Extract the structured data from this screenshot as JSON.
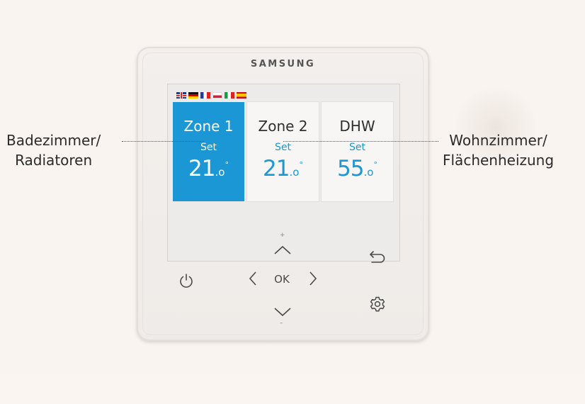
{
  "device": {
    "brand": "SAMSUNG",
    "languages": [
      "uk-flag-icon",
      "de-flag-icon",
      "fr-flag-icon",
      "pl-flag-icon",
      "it-flag-icon",
      "es-flag-icon"
    ],
    "zones": [
      {
        "title": "Zone 1",
        "set_label": "Set",
        "temp_int": "21",
        "temp_dec": ".o",
        "temp_deg": "°",
        "active": true
      },
      {
        "title": "Zone 2",
        "set_label": "Set",
        "temp_int": "21",
        "temp_dec": ".o",
        "temp_deg": "°",
        "active": false
      },
      {
        "title": "DHW",
        "set_label": "Set",
        "temp_int": "55",
        "temp_dec": ".o",
        "temp_deg": "°",
        "active": false
      }
    ],
    "buttons": {
      "ok_label": "OK",
      "plus_label": "+",
      "minus_label": "–"
    }
  },
  "callouts": {
    "left_line1": "Badezimmer/",
    "left_line2": "Radiatoren",
    "right_line1": "Wohnzimmer/",
    "right_line2": "Flächenheizung"
  },
  "colors": {
    "accent": "#1a97d4",
    "background": "#f9f4f0",
    "device": "#f1ede9"
  }
}
